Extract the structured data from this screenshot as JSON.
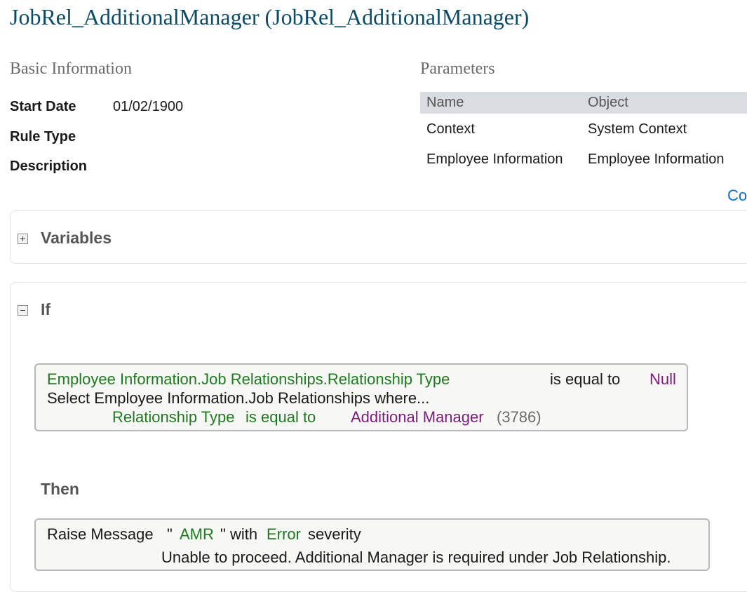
{
  "header": {
    "title": "JobRel_AdditionalManager (JobRel_AdditionalManager)"
  },
  "basic_info": {
    "heading": "Basic Information",
    "fields": [
      {
        "label": "Start Date",
        "value": "01/02/1900"
      },
      {
        "label": "Rule Type",
        "value": ""
      },
      {
        "label": "Description",
        "value": ""
      }
    ]
  },
  "parameters": {
    "heading": "Parameters",
    "columns": [
      "Name",
      "Object"
    ],
    "rows": [
      {
        "name": "Context",
        "object": "System Context"
      },
      {
        "name": "Employee Information",
        "object": "Employee Information"
      }
    ],
    "link_text": "Co"
  },
  "variables": {
    "title": "Variables",
    "expanded": false
  },
  "if_block": {
    "title": "If",
    "expanded": true,
    "condition": {
      "left_field": "Employee Information.Job Relationships.Relationship Type",
      "operator": "is equal to",
      "right_value": "Null",
      "select_text": "Select Employee Information.Job Relationships where...",
      "filter_field": "Relationship Type",
      "filter_operator": "is equal to",
      "filter_value": "Additional Manager",
      "filter_code": "(3786)"
    }
  },
  "then_block": {
    "title": "Then",
    "action": "Raise Message",
    "quote_open": "\"",
    "message_key": "AMR",
    "quote_close": "\"",
    "with_text": "with",
    "severity": "Error",
    "severity_suffix": "severity",
    "message_text": "Unable to proceed. Additional Manager is required under Job Relationship."
  },
  "colors": {
    "title": "#0b4b66",
    "field_green": "#1f7a1f",
    "value_purple": "#7a1c7a",
    "link_blue": "#0a6ed1"
  }
}
